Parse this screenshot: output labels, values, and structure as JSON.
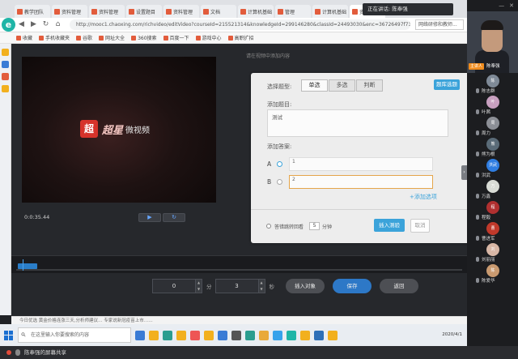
{
  "browser": {
    "tabs": [
      {
        "label": "教学团队",
        "color": "#e25c3c"
      },
      {
        "label": "资料管理",
        "color": "#e25c3c"
      },
      {
        "label": "资料管理",
        "color": "#e25c3c"
      },
      {
        "label": "设置题目",
        "color": "#e25c3c"
      },
      {
        "label": "资料管理",
        "color": "#e25c3c"
      },
      {
        "label": "文档",
        "color": "#e25c3c"
      },
      {
        "label": "计算机基础",
        "color": "#e25c3c"
      },
      {
        "label": "管理",
        "color": "#e25c3c"
      },
      {
        "label": "计算机基础",
        "color": "#e25c3c"
      },
      {
        "label": "资料编辑",
        "color": "#e25c3c",
        "active": true
      }
    ],
    "new_tab": "+",
    "meeting_badge": "正在讲话: 陈奉强",
    "url": "http://mooc1.chaoxing.com/richvideo/editVideo?courseId=215521314&knowledgeId=299146280&classId=24493030&enc=36726497f73515858",
    "search_placeholder": "网络研修和教师...",
    "bookmarks": [
      "收藏",
      "手机收藏夹",
      "谷歌",
      "网址大全",
      "360搜索",
      "百度一下",
      "游戏中心",
      "高职扩招"
    ]
  },
  "editor": {
    "hint": "请在视频中添加内容",
    "brand_logo": "超",
    "brand_name": "超星",
    "brand_sub": "微视频",
    "timecode": "0:0:35.44",
    "play_icon": "▶",
    "loop_icon": "↻",
    "question": {
      "type_label": "选择题型:",
      "types": [
        "单选",
        "多选",
        "判断"
      ],
      "active_type": 0,
      "bank_button": "题库选题",
      "title_label": "添加题目:",
      "title_value": "测试",
      "answer_label": "添加答案:",
      "options": [
        {
          "letter": "A",
          "value": "1",
          "selected": true
        },
        {
          "letter": "B",
          "value": "2",
          "selected": false
        }
      ],
      "add_option": "+添加选项",
      "timing_label": "答错跳转回看",
      "timing_value": "5",
      "timing_unit": "分钟",
      "insert_button": "插入测验",
      "cancel_button": "取消"
    },
    "controls": {
      "minutes": "0",
      "minutes_unit": "分",
      "seconds": "3",
      "seconds_unit": "秒",
      "insert_object": "插入对象",
      "save": "保存",
      "back": "返回"
    },
    "status": "今日优选  黄金价格连涨三天,分析师建议…  专家说新冠疫苗上市……",
    "collapse_icon": "›"
  },
  "taskbar": {
    "search_placeholder": "在这里输入你要搜索的内容",
    "icon_colors": [
      "#3a7bd5",
      "#f2b01e",
      "#2a9d8f",
      "#f2b01e",
      "#e55",
      "#f2b01e",
      "#3a7bd5",
      "#555",
      "#2a9d8f",
      "#e9a93a",
      "#36a2eb",
      "#1fb5a7",
      "#f2b01e",
      "#2d6fb7",
      "#f2b01e"
    ],
    "tray_time": "2020/4/1"
  },
  "meeting": {
    "bottom_text": "陈奉强的屏幕共享",
    "window_controls": [
      "—",
      "✕"
    ],
    "presenter": {
      "tag": "主讲人",
      "name": "陈奉强"
    },
    "participants": [
      {
        "name": "陈志群",
        "avatar": "陈",
        "color": "#7f8a97"
      },
      {
        "name": "叶茜",
        "avatar": "叶",
        "color": "#c8a0c0"
      },
      {
        "name": "周力",
        "avatar": "周",
        "color": "#8c8f96"
      },
      {
        "name": "熊为根",
        "avatar": "熊",
        "color": "#5a6b78"
      },
      {
        "name": "洪武",
        "avatar": "洪武",
        "color": "#2f7de1"
      },
      {
        "name": "万鑫",
        "avatar": "万",
        "color": "#d9dcd6"
      },
      {
        "name": "程毅",
        "avatar": "程",
        "color": "#b03030"
      },
      {
        "name": "曹进军",
        "avatar": "曹",
        "color": "#c0392b"
      },
      {
        "name": "刘丽丽",
        "avatar": "刘",
        "color": "#d8b7a6"
      },
      {
        "name": "陈爱华",
        "avatar": "陈",
        "color": "#c99a70"
      }
    ]
  }
}
